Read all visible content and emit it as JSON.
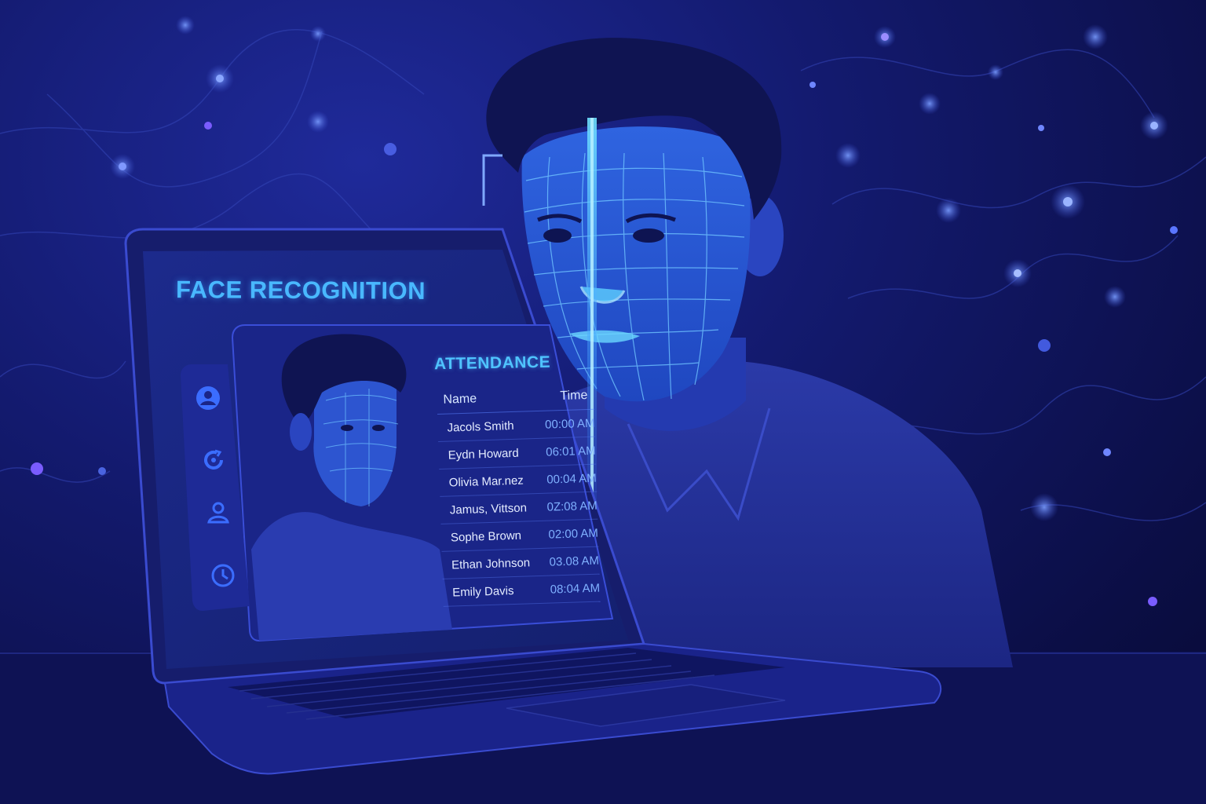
{
  "app": {
    "title": "FACE RECOGNITION"
  },
  "sidebar": {
    "items": [
      {
        "icon": "user-circle-icon"
      },
      {
        "icon": "refresh-icon"
      },
      {
        "icon": "user-icon"
      },
      {
        "icon": "clock-icon"
      }
    ]
  },
  "attendance": {
    "title": "ATTENDANCE",
    "headers": {
      "name": "Name",
      "time": "Time"
    },
    "rows": [
      {
        "name": "Jacols Smith",
        "time": "00:00 AM"
      },
      {
        "name": "Eydn Howard",
        "time": "06:01 AM"
      },
      {
        "name": "Olivia Mar.nez",
        "time": "00:04 AM"
      },
      {
        "name": "Jamus, Vittson",
        "time": "0Z:08 AM"
      },
      {
        "name": "Sophe Brown",
        "time": "02:00 AM"
      },
      {
        "name": "Ethan Johnson",
        "time": "03.08 AM"
      },
      {
        "name": "Emily Davis",
        "time": "08:04 AM"
      }
    ]
  },
  "colors": {
    "accent": "#49b8ff",
    "background": "#131a6e",
    "scan_beam": "#3fb4ff"
  }
}
